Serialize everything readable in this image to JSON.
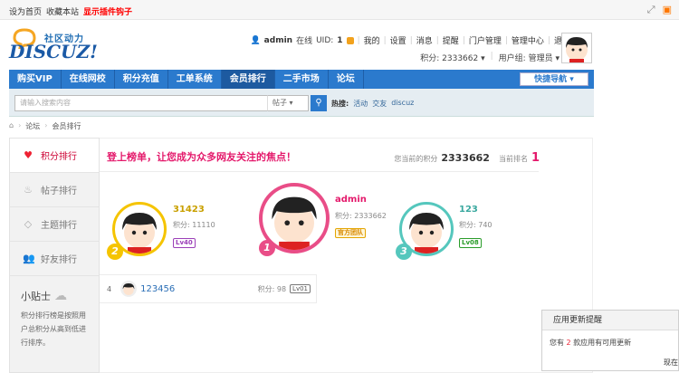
{
  "topbar": {
    "set_home": "设为首页",
    "bookmark": "收藏本站",
    "plugin_hook": "显示插件钩子"
  },
  "logo": {
    "tagline": "社区动力",
    "word": "DISCUZ!"
  },
  "user": {
    "name": "admin",
    "online": "在线",
    "uid_label": "UID:",
    "uid": "1",
    "links": [
      "我的",
      "设置",
      "消息",
      "提醒",
      "门户管理",
      "管理中心",
      "退出"
    ],
    "points_label": "积分:",
    "points": "2333662",
    "group_label": "用户组:",
    "group": "管理员"
  },
  "nav": {
    "items": [
      "购买VIP",
      "在线网校",
      "积分充值",
      "工单系统",
      "会员排行",
      "二手市场",
      "论坛"
    ],
    "active_index": 4,
    "quick": "快捷导航"
  },
  "search": {
    "placeholder": "请输入搜索内容",
    "scope": "帖子",
    "hot_label": "热搜:",
    "hot": [
      "活动",
      "交友",
      "discuz"
    ]
  },
  "breadcrumb": {
    "forum": "论坛",
    "page": "会员排行"
  },
  "sidebar": {
    "items": [
      {
        "label": "积分排行",
        "icon": "heart-icon",
        "active": true
      },
      {
        "label": "帖子排行",
        "icon": "flame-icon"
      },
      {
        "label": "主题排行",
        "icon": "diamond-icon"
      },
      {
        "label": "好友排行",
        "icon": "friends-icon"
      }
    ],
    "tip_title": "小贴士",
    "tip_body": "积分排行榜是按照用户总积分从高到低进行排序。"
  },
  "main": {
    "slogan": "登上榜单，让您成为众多网友关注的焦点！",
    "my_points_label": "您当前的积分",
    "my_points": "2333662",
    "rank_label": "当前排名",
    "rank": "1"
  },
  "podium": [
    {
      "rank": "1",
      "name": "admin",
      "score_label": "积分:",
      "score": "2333662",
      "badge": "官方团队",
      "color": "#e94d87"
    },
    {
      "rank": "2",
      "name": "31423",
      "score_label": "积分:",
      "score": "11110",
      "badge": "Lv40",
      "color": "#f5c400"
    },
    {
      "rank": "3",
      "name": "123",
      "score_label": "积分:",
      "score": "740",
      "badge": "Lv08",
      "color": "#55c7bd"
    }
  ],
  "list": [
    {
      "rank": "4",
      "name": "123456",
      "score_label": "积分:",
      "score": "98",
      "badge": "Lv01"
    }
  ],
  "popup": {
    "title": "应用更新提醒",
    "prefix": "您有",
    "count": "2",
    "suffix": "款应用有可用更新",
    "action": "现在"
  }
}
